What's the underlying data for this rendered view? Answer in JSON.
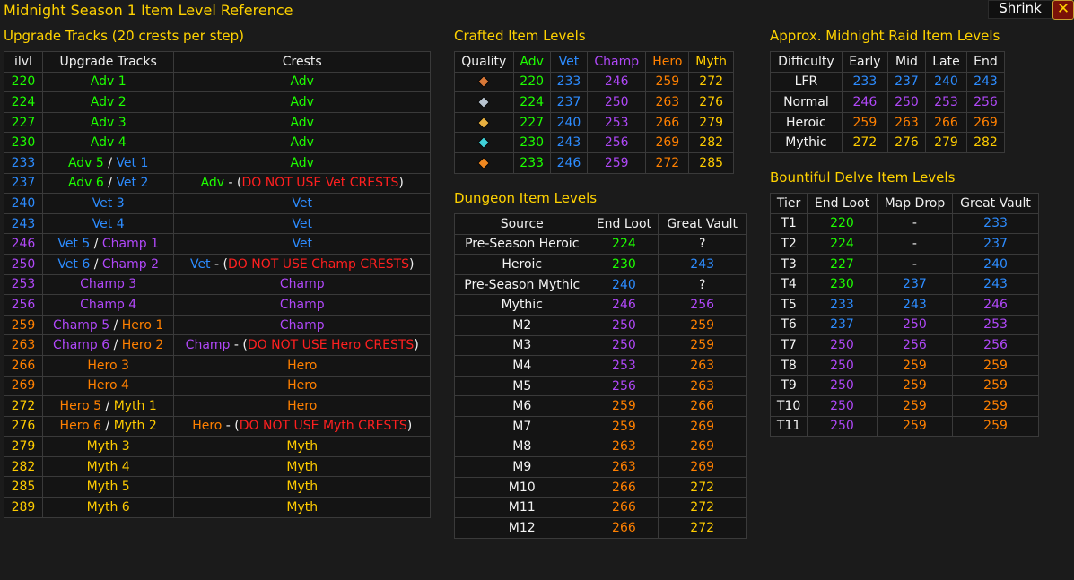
{
  "title": "Midnight Season 1 Item Level Reference",
  "buttons": {
    "shrink": "Shrink",
    "close": "✕"
  },
  "colors": {
    "adv": "#1eff00",
    "vet": "#2d8cff",
    "champ": "#b048f8",
    "hero": "#ff8000",
    "myth": "#ffcc00",
    "warn": "#ff2020",
    "heading": "#ffd200"
  },
  "upgrade": {
    "heading": "Upgrade Tracks  (20 crests per step)",
    "headers": [
      "ilvl",
      "Upgrade Tracks",
      "Crests"
    ],
    "rows": [
      {
        "ilvl": "220",
        "c": "adv",
        "track": [
          [
            "Adv 1",
            "adv"
          ]
        ],
        "crest": [
          [
            "Adv",
            "adv"
          ]
        ]
      },
      {
        "ilvl": "224",
        "c": "adv",
        "track": [
          [
            "Adv 2",
            "adv"
          ]
        ],
        "crest": [
          [
            "Adv",
            "adv"
          ]
        ]
      },
      {
        "ilvl": "227",
        "c": "adv",
        "track": [
          [
            "Adv 3",
            "adv"
          ]
        ],
        "crest": [
          [
            "Adv",
            "adv"
          ]
        ]
      },
      {
        "ilvl": "230",
        "c": "adv",
        "track": [
          [
            "Adv 4",
            "adv"
          ]
        ],
        "crest": [
          [
            "Adv",
            "adv"
          ]
        ]
      },
      {
        "ilvl": "233",
        "c": "vet",
        "track": [
          [
            "Adv 5",
            "adv"
          ],
          [
            " / ",
            "white"
          ],
          [
            "Vet 1",
            "vet"
          ]
        ],
        "crest": [
          [
            "Adv",
            "adv"
          ]
        ]
      },
      {
        "ilvl": "237",
        "c": "vet",
        "track": [
          [
            "Adv 6",
            "adv"
          ],
          [
            " / ",
            "white"
          ],
          [
            "Vet 2",
            "vet"
          ]
        ],
        "crest": [
          [
            "Adv",
            "adv"
          ],
          [
            " - (",
            "white"
          ],
          [
            "DO NOT USE Vet CRESTS",
            "warn"
          ],
          [
            ")",
            "white"
          ]
        ]
      },
      {
        "ilvl": "240",
        "c": "vet",
        "track": [
          [
            "Vet 3",
            "vet"
          ]
        ],
        "crest": [
          [
            "Vet",
            "vet"
          ]
        ]
      },
      {
        "ilvl": "243",
        "c": "vet",
        "track": [
          [
            "Vet 4",
            "vet"
          ]
        ],
        "crest": [
          [
            "Vet",
            "vet"
          ]
        ]
      },
      {
        "ilvl": "246",
        "c": "champ",
        "track": [
          [
            "Vet 5",
            "vet"
          ],
          [
            " / ",
            "white"
          ],
          [
            "Champ 1",
            "champ"
          ]
        ],
        "crest": [
          [
            "Vet",
            "vet"
          ]
        ]
      },
      {
        "ilvl": "250",
        "c": "champ",
        "track": [
          [
            "Vet 6",
            "vet"
          ],
          [
            " / ",
            "white"
          ],
          [
            "Champ 2",
            "champ"
          ]
        ],
        "crest": [
          [
            "Vet",
            "vet"
          ],
          [
            " - (",
            "white"
          ],
          [
            "DO NOT USE Champ CRESTS",
            "warn"
          ],
          [
            ")",
            "white"
          ]
        ]
      },
      {
        "ilvl": "253",
        "c": "champ",
        "track": [
          [
            "Champ 3",
            "champ"
          ]
        ],
        "crest": [
          [
            "Champ",
            "champ"
          ]
        ]
      },
      {
        "ilvl": "256",
        "c": "champ",
        "track": [
          [
            "Champ 4",
            "champ"
          ]
        ],
        "crest": [
          [
            "Champ",
            "champ"
          ]
        ]
      },
      {
        "ilvl": "259",
        "c": "hero",
        "track": [
          [
            "Champ 5",
            "champ"
          ],
          [
            " / ",
            "white"
          ],
          [
            "Hero 1",
            "hero"
          ]
        ],
        "crest": [
          [
            "Champ",
            "champ"
          ]
        ]
      },
      {
        "ilvl": "263",
        "c": "hero",
        "track": [
          [
            "Champ 6",
            "champ"
          ],
          [
            " / ",
            "white"
          ],
          [
            "Hero 2",
            "hero"
          ]
        ],
        "crest": [
          [
            "Champ",
            "champ"
          ],
          [
            " - (",
            "white"
          ],
          [
            "DO NOT USE Hero CRESTS",
            "warn"
          ],
          [
            ")",
            "white"
          ]
        ]
      },
      {
        "ilvl": "266",
        "c": "hero",
        "track": [
          [
            "Hero 3",
            "hero"
          ]
        ],
        "crest": [
          [
            "Hero",
            "hero"
          ]
        ]
      },
      {
        "ilvl": "269",
        "c": "hero",
        "track": [
          [
            "Hero 4",
            "hero"
          ]
        ],
        "crest": [
          [
            "Hero",
            "hero"
          ]
        ]
      },
      {
        "ilvl": "272",
        "c": "myth",
        "track": [
          [
            "Hero 5",
            "hero"
          ],
          [
            " / ",
            "white"
          ],
          [
            "Myth 1",
            "myth"
          ]
        ],
        "crest": [
          [
            "Hero",
            "hero"
          ]
        ]
      },
      {
        "ilvl": "276",
        "c": "myth",
        "track": [
          [
            "Hero 6",
            "hero"
          ],
          [
            " / ",
            "white"
          ],
          [
            "Myth 2",
            "myth"
          ]
        ],
        "crest": [
          [
            "Hero",
            "hero"
          ],
          [
            " - (",
            "white"
          ],
          [
            "DO NOT USE Myth CRESTS",
            "warn"
          ],
          [
            ")",
            "white"
          ]
        ]
      },
      {
        "ilvl": "279",
        "c": "myth",
        "track": [
          [
            "Myth 3",
            "myth"
          ]
        ],
        "crest": [
          [
            "Myth",
            "myth"
          ]
        ]
      },
      {
        "ilvl": "282",
        "c": "myth",
        "track": [
          [
            "Myth 4",
            "myth"
          ]
        ],
        "crest": [
          [
            "Myth",
            "myth"
          ]
        ]
      },
      {
        "ilvl": "285",
        "c": "myth",
        "track": [
          [
            "Myth 5",
            "myth"
          ]
        ],
        "crest": [
          [
            "Myth",
            "myth"
          ]
        ]
      },
      {
        "ilvl": "289",
        "c": "myth",
        "track": [
          [
            "Myth 6",
            "myth"
          ]
        ],
        "crest": [
          [
            "Myth",
            "myth"
          ]
        ]
      }
    ]
  },
  "crafted": {
    "heading": "Crafted Item Levels",
    "headers": [
      [
        "Quality",
        "white"
      ],
      [
        "Adv",
        "adv"
      ],
      [
        "Vet",
        "vet"
      ],
      [
        "Champ",
        "champ"
      ],
      [
        "Hero",
        "hero"
      ],
      [
        "Myth",
        "myth"
      ]
    ],
    "rows": [
      {
        "icon": "quality-1-icon",
        "gem": "#d87838",
        "values": [
          "220",
          "233",
          "246",
          "259",
          "272"
        ]
      },
      {
        "icon": "quality-2-icon",
        "gem": "#b8c4d0",
        "values": [
          "224",
          "237",
          "250",
          "263",
          "276"
        ]
      },
      {
        "icon": "quality-3-icon",
        "gem": "#e8b040",
        "values": [
          "227",
          "240",
          "253",
          "266",
          "279"
        ]
      },
      {
        "icon": "quality-4-icon",
        "gem": "#40d0d8",
        "values": [
          "230",
          "243",
          "256",
          "269",
          "282"
        ]
      },
      {
        "icon": "quality-5-icon",
        "gem": "#f08820",
        "values": [
          "233",
          "246",
          "259",
          "272",
          "285"
        ]
      }
    ]
  },
  "dungeon": {
    "heading": "Dungeon Item Levels",
    "headers": [
      "Source",
      "End Loot",
      "Great Vault"
    ],
    "rows": [
      {
        "src": "Pre-Season Heroic",
        "end": [
          "224",
          "adv"
        ],
        "vault": [
          "?",
          "white"
        ]
      },
      {
        "src": "Heroic",
        "end": [
          "230",
          "adv"
        ],
        "vault": [
          "243",
          "vet"
        ]
      },
      {
        "src": "Pre-Season Mythic",
        "end": [
          "240",
          "vet"
        ],
        "vault": [
          "?",
          "white"
        ]
      },
      {
        "src": "Mythic",
        "end": [
          "246",
          "champ"
        ],
        "vault": [
          "256",
          "champ"
        ]
      },
      {
        "src": "M2",
        "end": [
          "250",
          "champ"
        ],
        "vault": [
          "259",
          "hero"
        ]
      },
      {
        "src": "M3",
        "end": [
          "250",
          "champ"
        ],
        "vault": [
          "259",
          "hero"
        ]
      },
      {
        "src": "M4",
        "end": [
          "253",
          "champ"
        ],
        "vault": [
          "263",
          "hero"
        ]
      },
      {
        "src": "M5",
        "end": [
          "256",
          "champ"
        ],
        "vault": [
          "263",
          "hero"
        ]
      },
      {
        "src": "M6",
        "end": [
          "259",
          "hero"
        ],
        "vault": [
          "266",
          "hero"
        ]
      },
      {
        "src": "M7",
        "end": [
          "259",
          "hero"
        ],
        "vault": [
          "269",
          "hero"
        ]
      },
      {
        "src": "M8",
        "end": [
          "263",
          "hero"
        ],
        "vault": [
          "269",
          "hero"
        ]
      },
      {
        "src": "M9",
        "end": [
          "263",
          "hero"
        ],
        "vault": [
          "269",
          "hero"
        ]
      },
      {
        "src": "M10",
        "end": [
          "266",
          "hero"
        ],
        "vault": [
          "272",
          "myth"
        ]
      },
      {
        "src": "M11",
        "end": [
          "266",
          "hero"
        ],
        "vault": [
          "272",
          "myth"
        ]
      },
      {
        "src": "M12",
        "end": [
          "266",
          "hero"
        ],
        "vault": [
          "272",
          "myth"
        ]
      }
    ]
  },
  "raid": {
    "heading": "Approx. Midnight Raid Item Levels",
    "headers": [
      "Difficulty",
      "Early",
      "Mid",
      "Late",
      "End"
    ],
    "rows": [
      {
        "label": "LFR",
        "cells": [
          [
            "233",
            "vet"
          ],
          [
            "237",
            "vet"
          ],
          [
            "240",
            "vet"
          ],
          [
            "243",
            "vet"
          ]
        ]
      },
      {
        "label": "Normal",
        "cells": [
          [
            "246",
            "champ"
          ],
          [
            "250",
            "champ"
          ],
          [
            "253",
            "champ"
          ],
          [
            "256",
            "champ"
          ]
        ]
      },
      {
        "label": "Heroic",
        "cells": [
          [
            "259",
            "hero"
          ],
          [
            "263",
            "hero"
          ],
          [
            "266",
            "hero"
          ],
          [
            "269",
            "hero"
          ]
        ]
      },
      {
        "label": "Mythic",
        "cells": [
          [
            "272",
            "myth"
          ],
          [
            "276",
            "myth"
          ],
          [
            "279",
            "myth"
          ],
          [
            "282",
            "myth"
          ]
        ]
      }
    ]
  },
  "delve": {
    "heading": "Bountiful Delve Item Levels",
    "headers": [
      "Tier",
      "End Loot",
      "Map Drop",
      "Great Vault"
    ],
    "rows": [
      {
        "tier": "T1",
        "cells": [
          [
            "220",
            "adv"
          ],
          [
            "-",
            "white"
          ],
          [
            "233",
            "vet"
          ]
        ]
      },
      {
        "tier": "T2",
        "cells": [
          [
            "224",
            "adv"
          ],
          [
            "-",
            "white"
          ],
          [
            "237",
            "vet"
          ]
        ]
      },
      {
        "tier": "T3",
        "cells": [
          [
            "227",
            "adv"
          ],
          [
            "-",
            "white"
          ],
          [
            "240",
            "vet"
          ]
        ]
      },
      {
        "tier": "T4",
        "cells": [
          [
            "230",
            "adv"
          ],
          [
            "237",
            "vet"
          ],
          [
            "243",
            "vet"
          ]
        ]
      },
      {
        "tier": "T5",
        "cells": [
          [
            "233",
            "vet"
          ],
          [
            "243",
            "vet"
          ],
          [
            "246",
            "champ"
          ]
        ]
      },
      {
        "tier": "T6",
        "cells": [
          [
            "237",
            "vet"
          ],
          [
            "250",
            "champ"
          ],
          [
            "253",
            "champ"
          ]
        ]
      },
      {
        "tier": "T7",
        "cells": [
          [
            "250",
            "champ"
          ],
          [
            "256",
            "champ"
          ],
          [
            "256",
            "champ"
          ]
        ]
      },
      {
        "tier": "T8",
        "cells": [
          [
            "250",
            "champ"
          ],
          [
            "259",
            "hero"
          ],
          [
            "259",
            "hero"
          ]
        ]
      },
      {
        "tier": "T9",
        "cells": [
          [
            "250",
            "champ"
          ],
          [
            "259",
            "hero"
          ],
          [
            "259",
            "hero"
          ]
        ]
      },
      {
        "tier": "T10",
        "cells": [
          [
            "250",
            "champ"
          ],
          [
            "259",
            "hero"
          ],
          [
            "259",
            "hero"
          ]
        ]
      },
      {
        "tier": "T11",
        "cells": [
          [
            "250",
            "champ"
          ],
          [
            "259",
            "hero"
          ],
          [
            "259",
            "hero"
          ]
        ]
      }
    ]
  }
}
